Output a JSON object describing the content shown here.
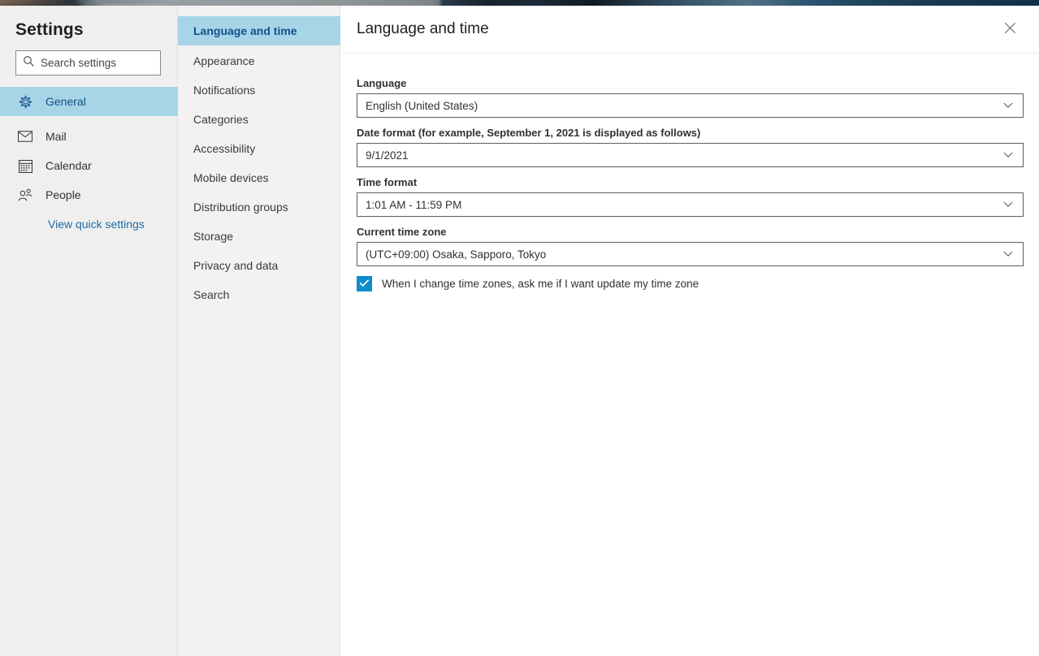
{
  "sidebar": {
    "title": "Settings",
    "search": {
      "placeholder": "Search settings",
      "value": "",
      "icon": "search-icon"
    },
    "items": [
      {
        "label": "General",
        "icon": "gear-icon",
        "selected": true
      },
      {
        "label": "Mail",
        "icon": "envelope-icon",
        "selected": false
      },
      {
        "label": "Calendar",
        "icon": "calendar-icon",
        "selected": false
      },
      {
        "label": "People",
        "icon": "person-icon",
        "selected": false
      }
    ],
    "quick_link": "View quick settings"
  },
  "subnav": {
    "items": [
      {
        "label": "Language and time",
        "selected": true
      },
      {
        "label": "Appearance",
        "selected": false
      },
      {
        "label": "Notifications",
        "selected": false
      },
      {
        "label": "Categories",
        "selected": false
      },
      {
        "label": "Accessibility",
        "selected": false
      },
      {
        "label": "Mobile devices",
        "selected": false
      },
      {
        "label": "Distribution groups",
        "selected": false
      },
      {
        "label": "Storage",
        "selected": false
      },
      {
        "label": "Privacy and data",
        "selected": false
      },
      {
        "label": "Search",
        "selected": false
      }
    ]
  },
  "main": {
    "title": "Language and time",
    "close_icon": "close-icon",
    "fields": [
      {
        "label": "Language",
        "value": "English (United States)",
        "icon": "chevron-down-icon"
      },
      {
        "label": "Date format (for example, September 1, 2021 is displayed as follows)",
        "value": "9/1/2021",
        "icon": "chevron-down-icon"
      },
      {
        "label": "Time format",
        "value": "1:01 AM - 11:59 PM",
        "icon": "chevron-down-icon"
      },
      {
        "label": "Current time zone",
        "value": "(UTC+09:00) Osaka, Sapporo, Tokyo",
        "icon": "chevron-down-icon"
      }
    ],
    "timezone_prompt": {
      "label": "When I change time zones, ask me if I want update my time zone",
      "checked": true,
      "icon": "checkmark-icon"
    }
  },
  "colors": {
    "selection": "#a8d4e8",
    "selection_text": "#10528a",
    "link": "#1a6ba8",
    "checkbox": "#0f8ccc",
    "panel_bg": "#f0efee",
    "subnav_bg": "#f3f2f1",
    "text": "#323130"
  }
}
